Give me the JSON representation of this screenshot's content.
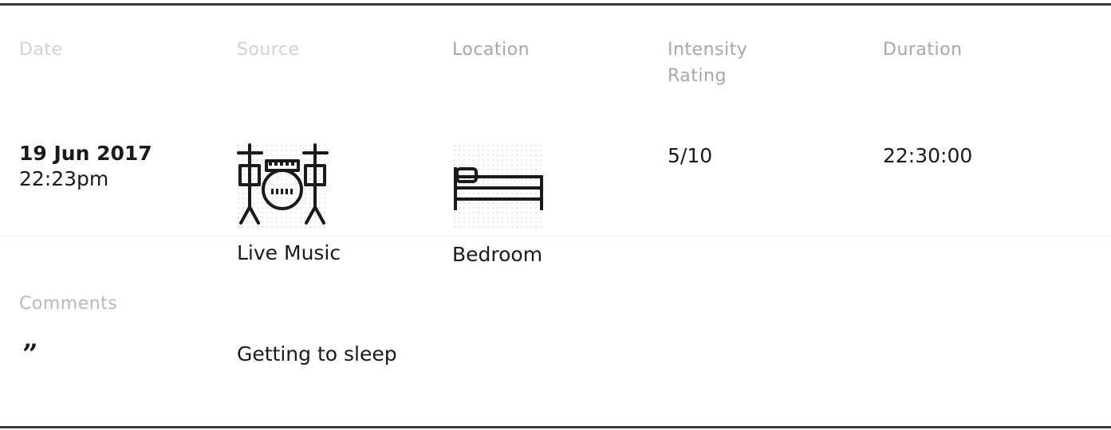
{
  "headers": {
    "date": "Date",
    "source": "Source",
    "location": "Location",
    "intensity": "Intensity Rating",
    "duration": "Duration"
  },
  "entry": {
    "date": "19 Jun 2017",
    "time": "22:23pm",
    "source": {
      "label": "Live Music",
      "icon": "drum-kit-icon"
    },
    "location": {
      "label": "Bedroom",
      "icon": "bed-icon"
    },
    "intensity": "5/10",
    "duration": "22:30:00"
  },
  "comments": {
    "label": "Comments",
    "icon": "quote-icon",
    "text": "Getting to sleep"
  }
}
